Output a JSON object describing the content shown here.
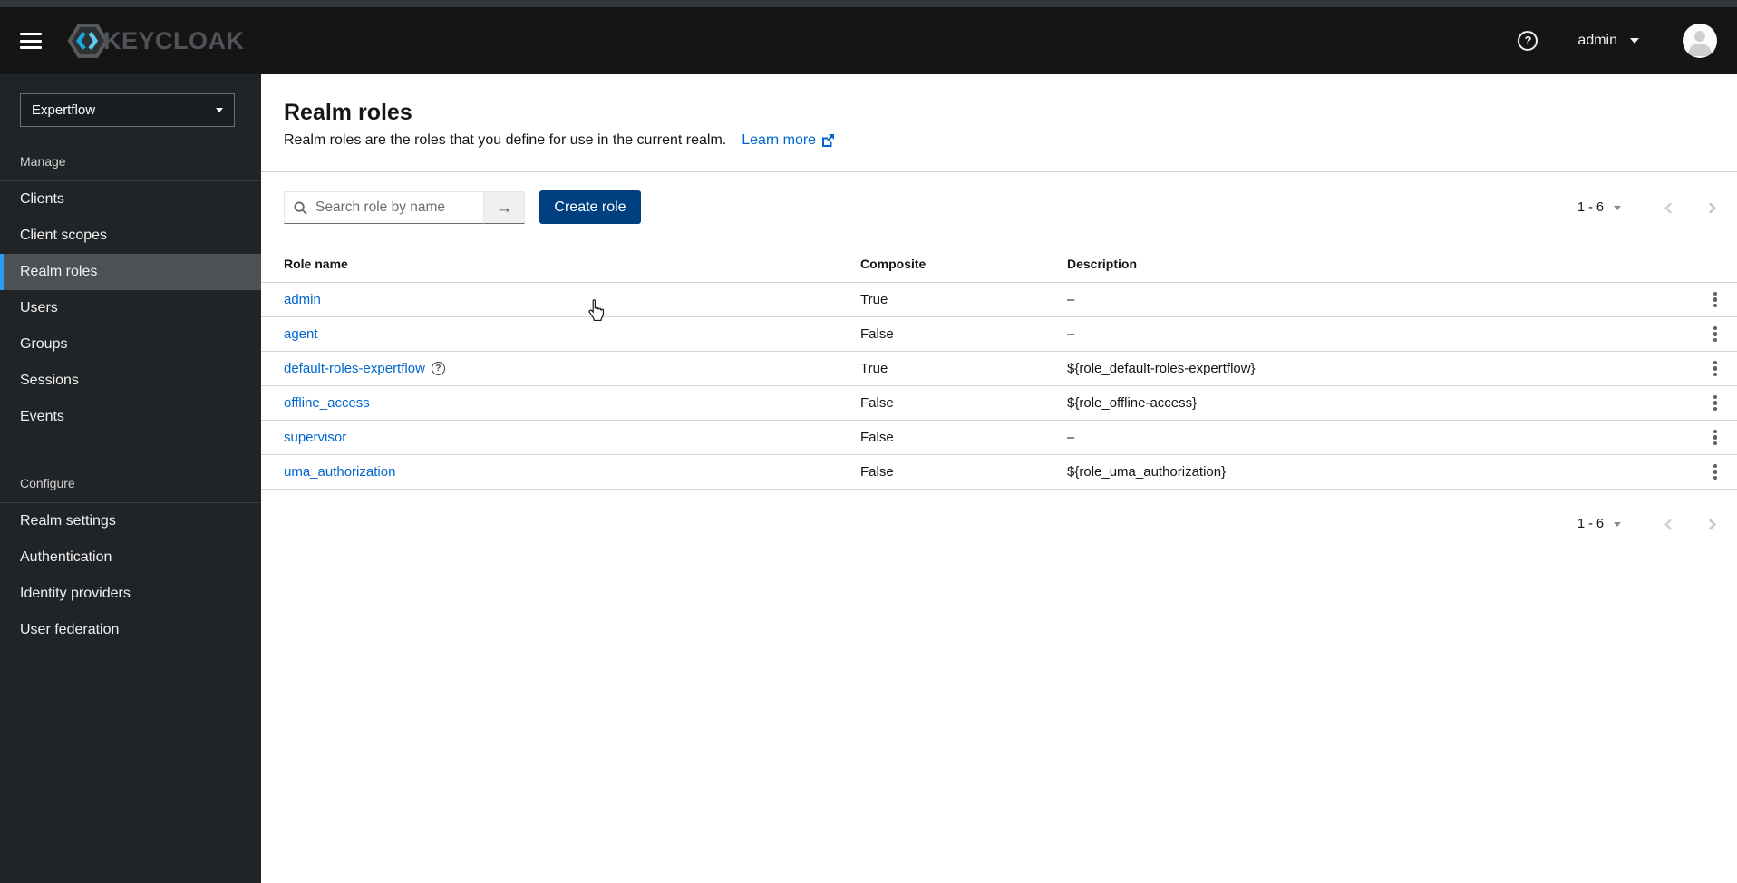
{
  "masthead": {
    "brand": "KEYCLOAK",
    "help_glyph": "?",
    "user": "admin"
  },
  "sidebar": {
    "realm": "Expertflow",
    "active_item": "Realm roles",
    "sections": [
      {
        "label": "Manage",
        "items": [
          "Clients",
          "Client scopes",
          "Realm roles",
          "Users",
          "Groups",
          "Sessions",
          "Events"
        ]
      },
      {
        "label": "Configure",
        "items": [
          "Realm settings",
          "Authentication",
          "Identity providers",
          "User federation"
        ]
      }
    ]
  },
  "page": {
    "title": "Realm roles",
    "subtitle": "Realm roles are the roles that you define for use in the current realm.",
    "learn_more": "Learn more"
  },
  "toolbar": {
    "search_placeholder": "Search role by name",
    "search_submit_glyph": "→",
    "create_button": "Create role",
    "pagination": {
      "range": "1 - 6"
    }
  },
  "table": {
    "columns": [
      "Role name",
      "Composite",
      "Description"
    ],
    "rows": [
      {
        "name": "admin",
        "composite": "True",
        "description": "–",
        "help": false
      },
      {
        "name": "agent",
        "composite": "False",
        "description": "–",
        "help": false
      },
      {
        "name": "default-roles-expertflow",
        "composite": "True",
        "description": "${role_default-roles-expertflow}",
        "help": true
      },
      {
        "name": "offline_access",
        "composite": "False",
        "description": "${role_offline-access}",
        "help": false
      },
      {
        "name": "supervisor",
        "composite": "False",
        "description": "–",
        "help": false
      },
      {
        "name": "uma_authorization",
        "composite": "False",
        "description": "${role_uma_authorization}",
        "help": false
      }
    ]
  },
  "icons": {
    "search": "magnifier",
    "kebab": "three-vertical-dots",
    "external_link": "box-with-arrow",
    "help": "question-circle"
  },
  "colors": {
    "accent_link": "#0066cc",
    "masthead_bg": "#151515",
    "sidebar_bg": "#212427",
    "active_nav_bg": "#4d5154",
    "active_nav_border": "#2b9af3",
    "primary_button_bg": "#004080",
    "divider": "#d2d2d2"
  }
}
